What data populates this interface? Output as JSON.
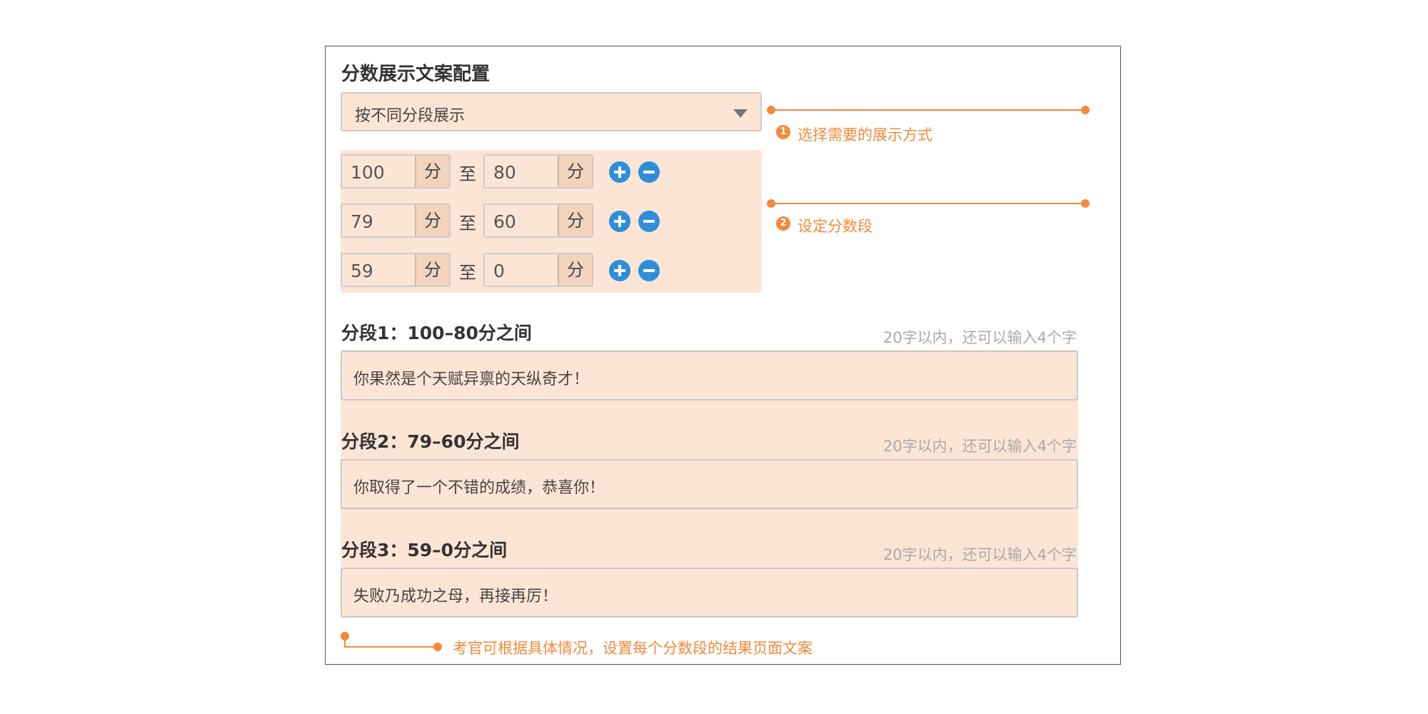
{
  "panel": {
    "title": "分数展示文案配置"
  },
  "display_select": {
    "value": "按不同分段展示"
  },
  "ranges": [
    {
      "from": "100",
      "from_unit": "分",
      "to_label": "至",
      "to": "80",
      "to_unit": "分"
    },
    {
      "from": "79",
      "from_unit": "分",
      "to_label": "至",
      "to": "60",
      "to_unit": "分"
    },
    {
      "from": "59",
      "from_unit": "分",
      "to_label": "至",
      "to": "0",
      "to_unit": "分"
    }
  ],
  "annotations": {
    "step1": {
      "num": "1",
      "text": "选择需要的展示方式"
    },
    "step2": {
      "num": "2",
      "text": "设定分数段"
    },
    "bottom": {
      "text": "考官可根据具体情况，设置每个分数段的结果页面文案"
    }
  },
  "segments": [
    {
      "label": "分段1：100–80分之间",
      "hint": "20字以内，还可以输入4个字",
      "text": "你果然是个天赋异禀的天纵奇才！"
    },
    {
      "label": "分段2：79–60分之间",
      "hint": "20字以内，还可以输入4个字",
      "text": "你取得了一个不错的成绩，恭喜你！"
    },
    {
      "label": "分段3：59–0分之间",
      "hint": "20字以内，还可以输入4个字",
      "text": "失败乃成功之母，再接再厉！"
    }
  ],
  "colors": {
    "accent": "#f28a3c",
    "field_bg": "#fde5d5",
    "button": "#2e8fd8"
  }
}
